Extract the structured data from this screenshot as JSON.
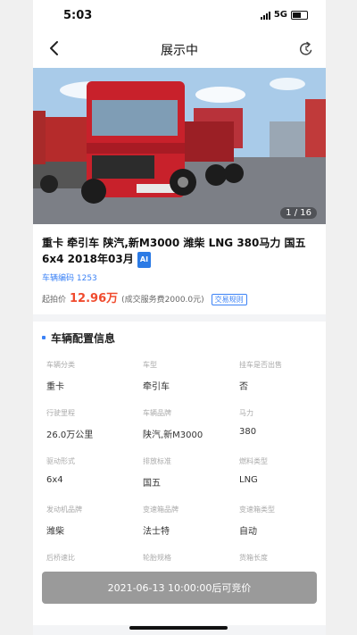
{
  "status": {
    "time": "5:03",
    "network": "5G"
  },
  "nav": {
    "title": "展示中"
  },
  "gallery": {
    "counter": "1 / 16"
  },
  "vehicle": {
    "title": "重卡 牵引车 陕汽,新M3000 潍柴 LNG 380马力 国五 6x4 2018年03月",
    "ai_badge": "AI",
    "code": "车辆编码 1253",
    "price_label": "起拍价",
    "price": "12.96万",
    "fee_note": "(成交服务费2000.0元)",
    "rules_button": "交易规则"
  },
  "config": {
    "heading": "车辆配置信息",
    "rows": [
      [
        {
          "k": "车辆分类",
          "v": "重卡"
        },
        {
          "k": "车型",
          "v": "牵引车"
        },
        {
          "k": "挂车是否出售",
          "v": "否"
        }
      ],
      [
        {
          "k": "行驶里程",
          "v": "26.0万公里"
        },
        {
          "k": "车辆品牌",
          "v": "陕汽,新M3000"
        },
        {
          "k": "马力",
          "v": "380"
        }
      ],
      [
        {
          "k": "驱动形式",
          "v": "6x4"
        },
        {
          "k": "排放标准",
          "v": "国五"
        },
        {
          "k": "燃料类型",
          "v": "LNG"
        }
      ],
      [
        {
          "k": "发动机品牌",
          "v": "潍柴"
        },
        {
          "k": "变速箱品牌",
          "v": "法士特"
        },
        {
          "k": "变速箱类型",
          "v": "自动"
        }
      ],
      [
        {
          "k": "后桥速比",
          "v": ""
        },
        {
          "k": "轮胎规格",
          "v": ""
        },
        {
          "k": "货箱长度",
          "v": ""
        }
      ]
    ]
  },
  "bid_button": "2021-06-13 10:00:00后可竞价",
  "colors": {
    "accent": "#3b82f6",
    "price": "#f04b2e",
    "truck": "#c8212b",
    "disabled_button": "#9a9a9a"
  }
}
